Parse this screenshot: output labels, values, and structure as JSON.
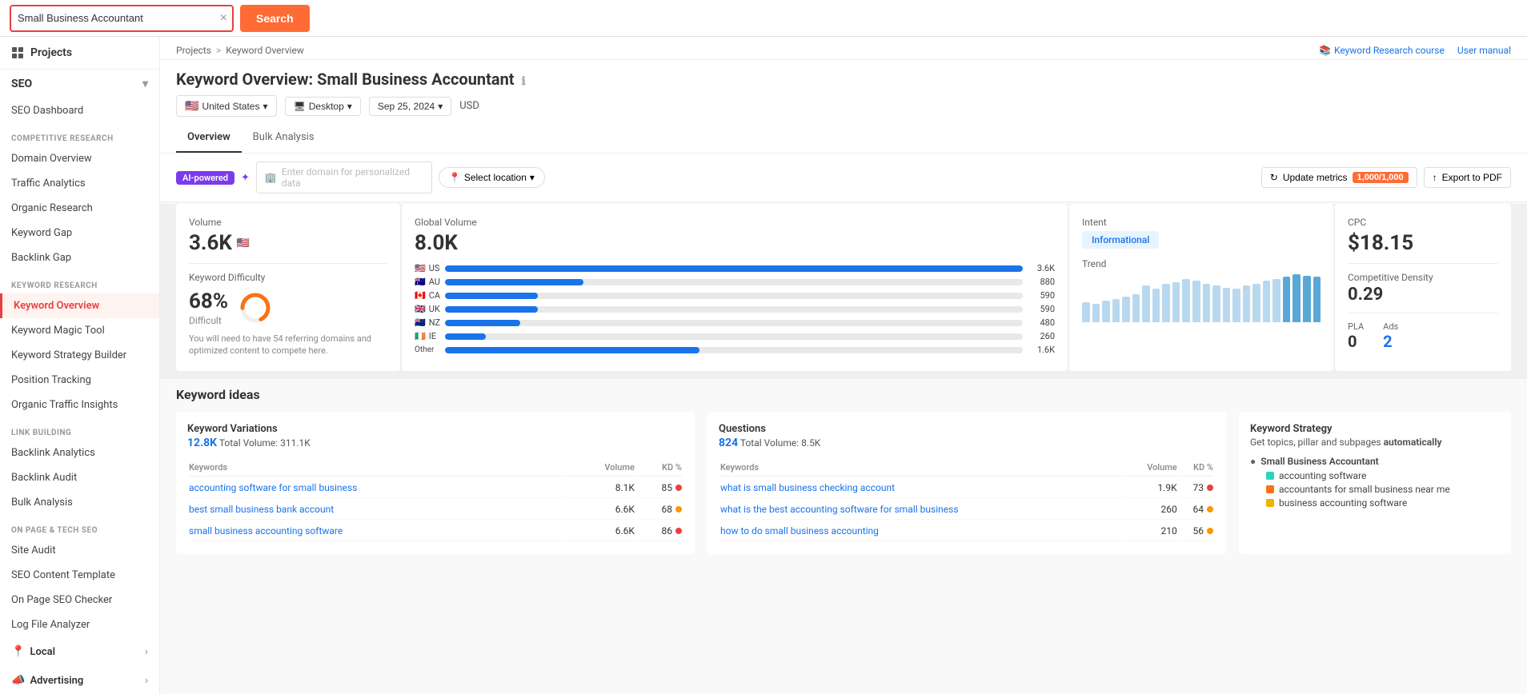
{
  "topbar": {
    "search_value": "Small Business Accountant",
    "search_placeholder": "Small Business Accountant",
    "search_btn": "Search",
    "clear_icon": "×"
  },
  "breadcrumb": {
    "projects": "Projects",
    "separator": ">",
    "current": "Keyword Overview",
    "right_links": [
      {
        "label": "Keyword Research course",
        "icon": "book-icon"
      },
      {
        "label": "User manual",
        "icon": "manual-icon"
      }
    ]
  },
  "page": {
    "title_prefix": "Keyword Overview:",
    "keyword": "Small Business Accountant",
    "filters": {
      "country": "United States",
      "device": "Desktop",
      "date": "Sep 25, 2024",
      "currency": "USD"
    },
    "tabs": [
      {
        "label": "Overview",
        "active": true
      },
      {
        "label": "Bulk Analysis",
        "active": false
      }
    ]
  },
  "controls": {
    "ai_label": "AI-powered",
    "domain_placeholder": "Enter domain for personalized data",
    "location_btn": "Select location",
    "update_btn": "Update metrics",
    "quota": "1,000/1,000",
    "export_btn": "Export to PDF"
  },
  "metrics": {
    "volume": {
      "label": "Volume",
      "value": "3.6K",
      "flag": "🇺🇸"
    },
    "keyword_difficulty": {
      "label": "Keyword Difficulty",
      "value": "68%",
      "difficulty_label": "Difficult",
      "description": "You will need to have 54 referring domains and optimized content to compete here.",
      "percentage": 68
    },
    "global_volume": {
      "label": "Global Volume",
      "value": "8.0K",
      "bars": [
        {
          "country": "US",
          "flag": "🇺🇸",
          "value": 3600,
          "max": 3600,
          "label": "3.6K",
          "fill_pct": 100
        },
        {
          "country": "AU",
          "flag": "🇦🇺",
          "value": 880,
          "max": 3600,
          "label": "880",
          "fill_pct": 24
        },
        {
          "country": "CA",
          "flag": "🇨🇦",
          "value": 590,
          "max": 3600,
          "label": "590",
          "fill_pct": 16
        },
        {
          "country": "UK",
          "flag": "🇬🇧",
          "value": 590,
          "max": 3600,
          "label": "590",
          "fill_pct": 16
        },
        {
          "country": "NZ",
          "flag": "🇳🇿",
          "value": 480,
          "max": 3600,
          "label": "480",
          "fill_pct": 13
        },
        {
          "country": "IE",
          "flag": "🇮🇪",
          "value": 260,
          "max": 3600,
          "label": "260",
          "fill_pct": 7
        },
        {
          "country": "Other",
          "flag": "",
          "value": 1600,
          "max": 3600,
          "label": "1.6K",
          "fill_pct": 44
        }
      ]
    },
    "intent": {
      "label": "Intent",
      "value": "Informational"
    },
    "trend": {
      "label": "Trend",
      "bars": [
        30,
        28,
        32,
        35,
        38,
        42,
        55,
        50,
        58,
        60,
        65,
        62,
        58,
        55,
        52,
        50,
        55,
        58,
        62,
        65,
        68,
        72,
        70,
        68
      ]
    },
    "cpc": {
      "label": "CPC",
      "value": "$18.15"
    },
    "competitive_density": {
      "label": "Competitive Density",
      "value": "0.29"
    },
    "pla": {
      "label": "PLA",
      "value": "0"
    },
    "ads": {
      "label": "Ads",
      "value": "2"
    }
  },
  "keyword_ideas": {
    "title": "Keyword ideas",
    "variations": {
      "title": "Keyword Variations",
      "count": "12.8K",
      "total_volume_label": "Total Volume:",
      "total_volume": "311.1K",
      "cols": [
        "Keywords",
        "Volume",
        "KD %"
      ],
      "rows": [
        {
          "keyword": "accounting software for small business",
          "volume": "8.1K",
          "kd": "85",
          "dot_color": "red"
        },
        {
          "keyword": "best small business bank account",
          "volume": "6.6K",
          "kd": "68",
          "dot_color": "orange"
        },
        {
          "keyword": "small business accounting software",
          "volume": "6.6K",
          "kd": "86",
          "dot_color": "red"
        }
      ]
    },
    "questions": {
      "title": "Questions",
      "count": "824",
      "total_volume_label": "Total Volume:",
      "total_volume": "8.5K",
      "cols": [
        "Keywords",
        "Volume",
        "KD %"
      ],
      "rows": [
        {
          "keyword": "what is small business checking account",
          "volume": "1.9K",
          "kd": "73",
          "dot_color": "red"
        },
        {
          "keyword": "what is the best accounting software for small business",
          "volume": "260",
          "kd": "64",
          "dot_color": "orange"
        },
        {
          "keyword": "how to do small business accounting",
          "volume": "210",
          "kd": "56",
          "dot_color": "orange"
        }
      ]
    },
    "strategy": {
      "title": "Keyword Strategy",
      "description_prefix": "Get topics, pillar and subpages ",
      "description_bold": "automatically",
      "root": "Small Business Accountant",
      "items": [
        {
          "label": "accounting software",
          "color": "dot-teal"
        },
        {
          "label": "accountants for small business near me",
          "color": "dot-orange"
        },
        {
          "label": "business accounting software",
          "color": "dot-yellow"
        }
      ]
    }
  },
  "sidebar": {
    "projects_label": "Projects",
    "seo_label": "SEO",
    "seo_dash": "SEO Dashboard",
    "competitive_research_header": "COMPETITIVE RESEARCH",
    "competitive_items": [
      {
        "label": "Domain Overview"
      },
      {
        "label": "Traffic Analytics"
      },
      {
        "label": "Organic Research"
      },
      {
        "label": "Keyword Gap"
      },
      {
        "label": "Backlink Gap"
      }
    ],
    "keyword_research_header": "KEYWORD RESEARCH",
    "keyword_items": [
      {
        "label": "Keyword Overview",
        "active": true
      },
      {
        "label": "Keyword Magic Tool"
      },
      {
        "label": "Keyword Strategy Builder"
      },
      {
        "label": "Position Tracking"
      },
      {
        "label": "Organic Traffic Insights"
      }
    ],
    "link_building_header": "LINK BUILDING",
    "link_items": [
      {
        "label": "Backlink Analytics"
      },
      {
        "label": "Backlink Audit"
      },
      {
        "label": "Bulk Analysis"
      }
    ],
    "on_page_header": "ON PAGE & TECH SEO",
    "on_page_items": [
      {
        "label": "Site Audit"
      },
      {
        "label": "SEO Content Template"
      },
      {
        "label": "On Page SEO Checker"
      },
      {
        "label": "Log File Analyzer"
      }
    ],
    "local_label": "Local",
    "advertising_label": "Advertising"
  }
}
